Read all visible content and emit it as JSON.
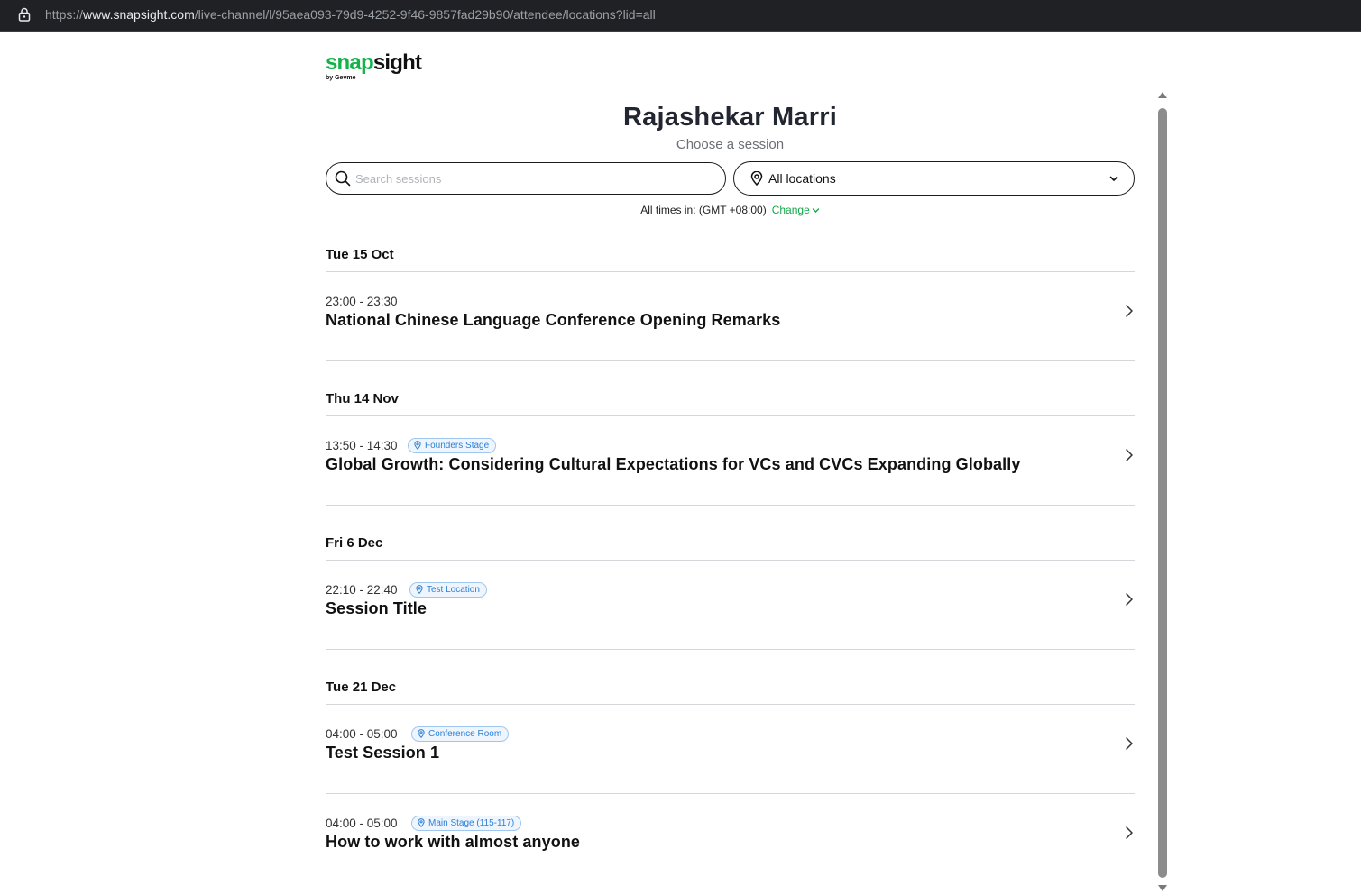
{
  "browser": {
    "url_prefix": "https://",
    "url_host": "www.snapsight.com",
    "url_path": "/live-channel/l/95aea093-79d9-4252-9f46-9857fad29b90/attendee/locations?lid=all"
  },
  "logo": {
    "snap": "snap",
    "sight": "sight",
    "by": "by Gevme"
  },
  "header": {
    "name": "Rajashekar Marri",
    "subtitle": "Choose a session"
  },
  "search": {
    "placeholder": "Search sessions",
    "value": ""
  },
  "location_filter": {
    "selected": "All locations"
  },
  "timezone": {
    "label": "All times in: (GMT +08:00)",
    "change": "Change"
  },
  "days": [
    {
      "date": "Tue 15 Oct"
    },
    {
      "date": "Thu 14 Nov"
    },
    {
      "date": "Fri 6 Dec"
    },
    {
      "date": "Tue 21 Dec"
    }
  ],
  "sessions": [
    {
      "time": "23:00 - 23:30",
      "location": "",
      "title": "National Chinese Language Conference Opening Remarks"
    },
    {
      "time": "13:50 - 14:30",
      "location": "Founders Stage",
      "title": "Global Growth: Considering Cultural Expectations for VCs and CVCs Expanding Globally"
    },
    {
      "time": "22:10 - 22:40",
      "location": "Test Location",
      "title": "Session Title"
    },
    {
      "time": "04:00 - 05:00",
      "location": "Conference Room",
      "title": "Test Session 1"
    },
    {
      "time": "04:00 - 05:00",
      "location": "Main Stage (115-117)",
      "title": "How to work with almost anyone"
    }
  ],
  "colors": {
    "accent": "#14b24a",
    "badge_text": "#2c7fd6",
    "badge_bg": "#eef5fd"
  }
}
